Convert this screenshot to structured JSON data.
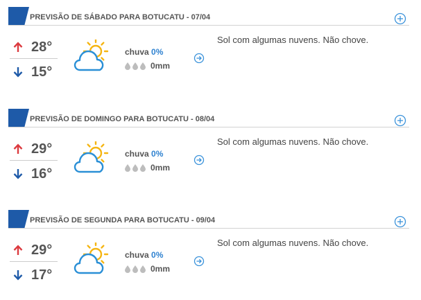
{
  "forecasts": [
    {
      "title": "PREVISÃO DE SÁBADO PARA BOTUCATU - 07/04",
      "temp_max": "28°",
      "temp_min": "15°",
      "rain_label": "chuva",
      "rain_probability": "0%",
      "rain_volume": "0mm",
      "description": "Sol com algumas nuvens. Não chove.",
      "condition_icon": "sun-behind-cloud-icon"
    },
    {
      "title": "PREVISÃO DE DOMINGO PARA BOTUCATU - 08/04",
      "temp_max": "29°",
      "temp_min": "16°",
      "rain_label": "chuva",
      "rain_probability": "0%",
      "rain_volume": "0mm",
      "description": "Sol com algumas nuvens. Não chove.",
      "condition_icon": "sun-behind-cloud-icon"
    },
    {
      "title": "PREVISÃO DE SEGUNDA PARA BOTUCATU - 09/04",
      "temp_max": "29°",
      "temp_min": "17°",
      "rain_label": "chuva",
      "rain_probability": "0%",
      "rain_volume": "0mm",
      "description": "Sol com algumas nuvens. Não chove.",
      "condition_icon": "sun-behind-cloud-icon"
    }
  ],
  "icons": {
    "section_marker": "flag-marker",
    "expand": "plus-circle-icon",
    "max_temp": "arrow-up-icon",
    "min_temp": "arrow-down-icon",
    "rain": "raindrop-icon",
    "details": "arrow-right-circle-icon"
  },
  "colors": {
    "accent": "#1e5aa8",
    "link": "#3a92da",
    "max": "#dc3a3f",
    "min": "#1e5aa8",
    "sun": "#f5b512",
    "drop": "#bdbdbd",
    "text": "#555555"
  }
}
